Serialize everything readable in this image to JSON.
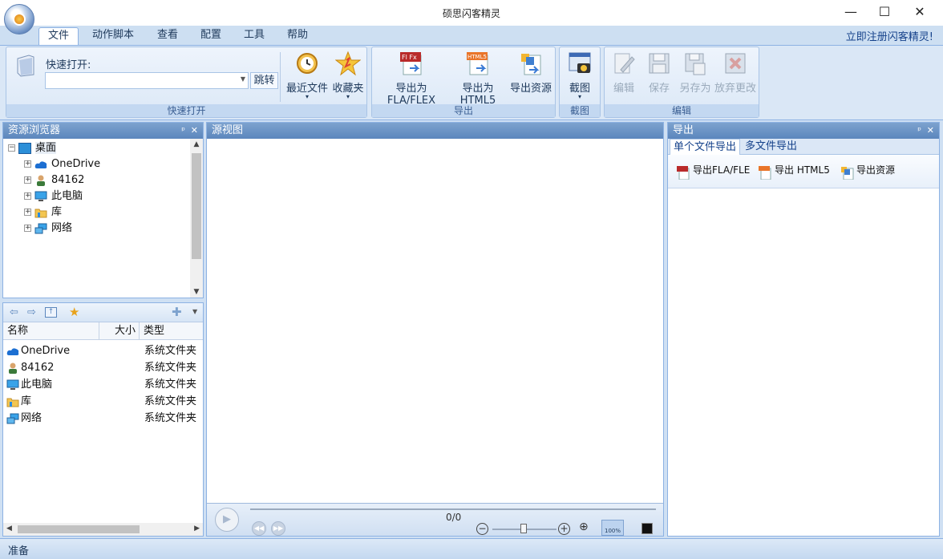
{
  "window": {
    "title": "硕思闪客精灵",
    "minimize": "—",
    "maximize": "☐",
    "close": "✕"
  },
  "menu": {
    "tabs": [
      "文件",
      "动作脚本",
      "查看",
      "配置",
      "工具",
      "帮助"
    ],
    "active": "文件",
    "register": "立即注册闪客精灵!"
  },
  "ribbon": {
    "quickopen": {
      "label": "快速打开:",
      "input_value": "",
      "go": "跳转",
      "recent": "最近文件",
      "favorites": "收藏夹",
      "caption": "快速打开"
    },
    "export": {
      "fla": "导出为FLA/FLEX",
      "html5": "导出为HTML5",
      "resources": "导出资源",
      "caption": "导出"
    },
    "capture": {
      "button": "截图",
      "caption": "截图"
    },
    "edit": {
      "edit": "编辑",
      "save": "保存",
      "save_as": "另存为",
      "discard": "放弃更改",
      "caption": "编辑"
    }
  },
  "resource_browser": {
    "title": "资源浏览器",
    "tree": [
      "桌面",
      "OneDrive",
      "84162",
      "此电脑",
      "库",
      "网络"
    ],
    "list_headers": [
      "名称",
      "大小",
      "类型"
    ],
    "rows": [
      {
        "name": "OneDrive",
        "type": "系统文件夹"
      },
      {
        "name": "84162",
        "type": "系统文件夹"
      },
      {
        "name": "此电脑",
        "type": "系统文件夹"
      },
      {
        "name": "库",
        "type": "系统文件夹"
      },
      {
        "name": "网络",
        "type": "系统文件夹"
      }
    ]
  },
  "source_view": {
    "title": "源视图",
    "frame_counter": "0/0",
    "zoom_badge": "100%"
  },
  "export_panel": {
    "title": "导出",
    "tabs": [
      "单个文件导出",
      "多文件导出"
    ],
    "buttons": [
      "导出FLA/FLE",
      "导出 HTML5",
      "导出资源"
    ]
  },
  "status": {
    "text": "准备"
  }
}
